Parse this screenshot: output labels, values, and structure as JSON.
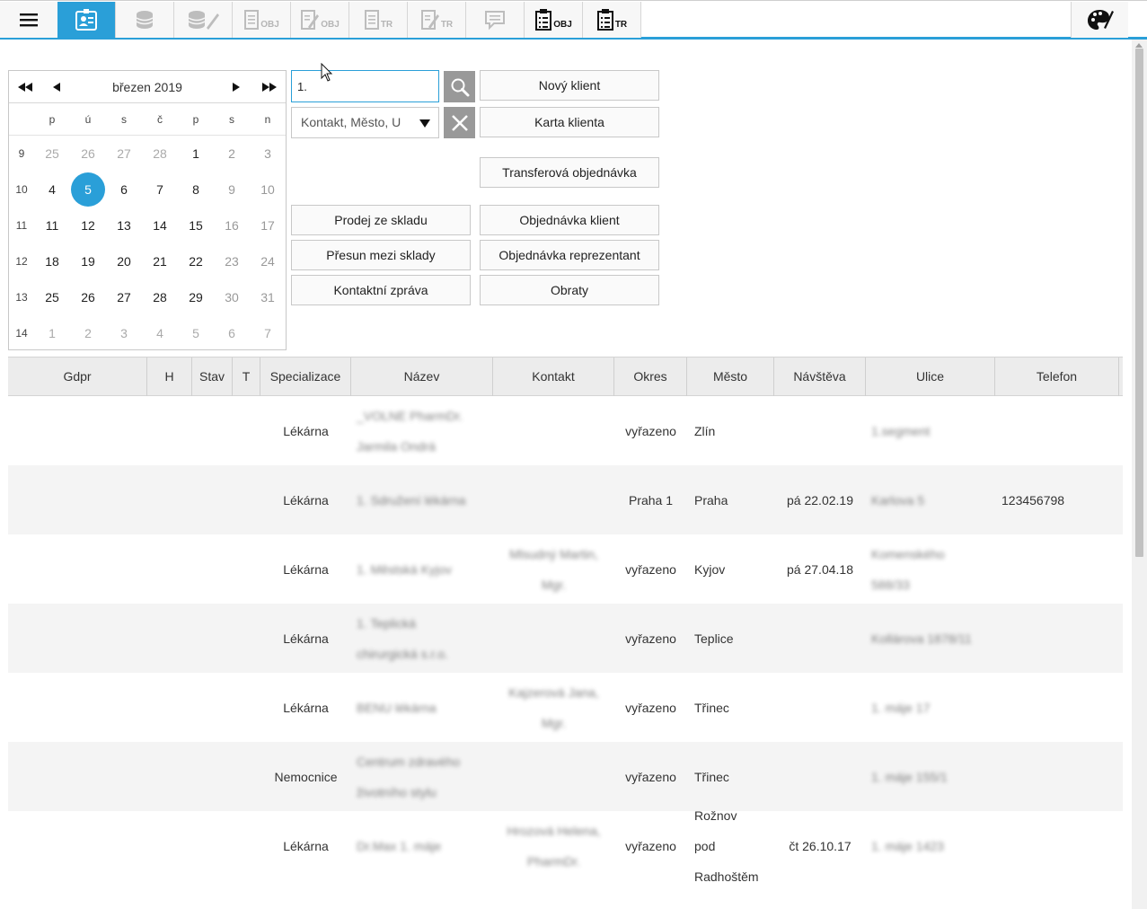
{
  "toolbar": {
    "items": [
      {
        "icon": "menu-icon"
      },
      {
        "icon": "client-card-icon",
        "active": true
      },
      {
        "icon": "coins-icon"
      },
      {
        "icon": "coins-edit-icon"
      },
      {
        "icon": "document-icon",
        "label": "OBJ"
      },
      {
        "icon": "document-edit-icon",
        "label": "OBJ"
      },
      {
        "icon": "document-icon",
        "label": "TR"
      },
      {
        "icon": "document-edit-icon",
        "label": "TR"
      },
      {
        "icon": "comment-icon"
      },
      {
        "icon": "clipboard-list-icon",
        "label": "OBJ"
      },
      {
        "icon": "clipboard-list-icon",
        "label": "TR"
      }
    ],
    "right_icon": "palette-icon"
  },
  "calendar": {
    "month_label": "březen 2019",
    "weekdays": [
      "p",
      "ú",
      "s",
      "č",
      "p",
      "s",
      "n"
    ],
    "weeks": [
      {
        "num": "9",
        "days": [
          "25",
          "26",
          "27",
          "28",
          "1",
          "2",
          "3"
        ]
      },
      {
        "num": "10",
        "days": [
          "4",
          "5",
          "6",
          "7",
          "8",
          "9",
          "10"
        ]
      },
      {
        "num": "11",
        "days": [
          "11",
          "12",
          "13",
          "14",
          "15",
          "16",
          "17"
        ]
      },
      {
        "num": "12",
        "days": [
          "18",
          "19",
          "20",
          "21",
          "22",
          "23",
          "24"
        ]
      },
      {
        "num": "13",
        "days": [
          "25",
          "26",
          "27",
          "28",
          "29",
          "30",
          "31"
        ]
      },
      {
        "num": "14",
        "days": [
          "1",
          "2",
          "3",
          "4",
          "5",
          "6",
          "7"
        ]
      }
    ],
    "selected": "5"
  },
  "search": {
    "value": "1.",
    "filter_value": "Kontakt, Město, U"
  },
  "buttons": {
    "new_client": "Nový klient",
    "client_card": "Karta klienta",
    "transfer_order": "Transferová objednávka",
    "stock_sale": "Prodej ze skladu",
    "stock_transfer": "Přesun mezi sklady",
    "contact_report": "Kontaktní zpráva",
    "client_order": "Objednávka klient",
    "rep_order": "Objednávka reprezentant",
    "turnover": "Obraty"
  },
  "table": {
    "headers": [
      "Gdpr",
      "H",
      "Stav",
      "T",
      "Specializace",
      "Název",
      "Kontakt",
      "Okres",
      "Město",
      "Návštěva",
      "Ulice",
      "Telefon"
    ],
    "rows": [
      {
        "spec": "Lékárna",
        "name": [
          "_VOLNE PharmDr.",
          "Jarmila Ondrá"
        ],
        "contact": [],
        "okres": "vyřazeno",
        "mesto": [
          "Zlín"
        ],
        "navsteva": "",
        "ulice": [
          "1.segment"
        ],
        "telefon": ""
      },
      {
        "spec": "Lékárna",
        "name": [
          "1. Sdružení lékárna"
        ],
        "contact": [],
        "okres": "Praha 1",
        "mesto": [
          "Praha"
        ],
        "navsteva": "pá 22.02.19",
        "ulice": [
          "Karlova 5"
        ],
        "telefon": "123456798"
      },
      {
        "spec": "Lékárna",
        "name": [
          "1. Městská Kyjov"
        ],
        "contact": [
          "Mlsudný Martin,",
          "Mgr."
        ],
        "okres": "vyřazeno",
        "mesto": [
          "Kyjov"
        ],
        "navsteva": "pá 27.04.18",
        "ulice": [
          "Komenského",
          "588/33"
        ],
        "telefon": ""
      },
      {
        "spec": "Lékárna",
        "name": [
          "1. Teplická",
          "chirurgická s.r.o."
        ],
        "contact": [],
        "okres": "vyřazeno",
        "mesto": [
          "Teplice"
        ],
        "navsteva": "",
        "ulice": [
          "Kollárova 1878/11"
        ],
        "telefon": ""
      },
      {
        "spec": "Lékárna",
        "name": [
          "BENU lékárna"
        ],
        "contact": [
          "Kajzerová Jana,",
          "Mgr."
        ],
        "okres": "vyřazeno",
        "mesto": [
          "Třinec"
        ],
        "navsteva": "",
        "ulice": [
          "1. máje 17"
        ],
        "telefon": ""
      },
      {
        "spec": "Nemocnice",
        "name": [
          "Centrum zdravého",
          "životního stylu"
        ],
        "contact": [],
        "okres": "vyřazeno",
        "mesto": [
          "Třinec"
        ],
        "navsteva": "",
        "ulice": [
          "1. máje 155/1"
        ],
        "telefon": ""
      },
      {
        "spec": "Lékárna",
        "name": [
          "Dr.Max 1. máje"
        ],
        "contact": [
          "Hrozová Helena,",
          "PharmDr."
        ],
        "okres": "vyřazeno",
        "mesto": [
          "Rožnov",
          "pod",
          "Radhoštěm"
        ],
        "navsteva": "čt 26.10.17",
        "ulice": [
          "1. máje 1423"
        ],
        "telefon": ""
      }
    ]
  },
  "colors": {
    "accent": "#2a9fd8",
    "header_bg": "#ececec",
    "row_alt": "#f4f4f4"
  }
}
